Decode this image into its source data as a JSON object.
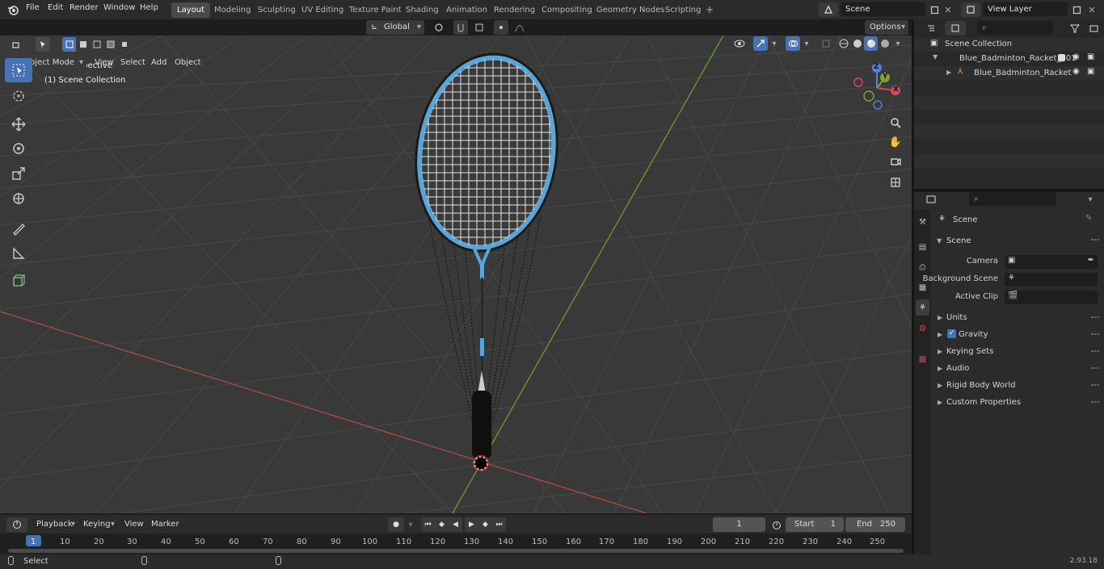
{
  "menu": {
    "items": [
      "File",
      "Edit",
      "Render",
      "Window",
      "Help"
    ]
  },
  "workspaces": [
    "Layout",
    "Modeling",
    "Sculpting",
    "UV Editing",
    "Texture Paint",
    "Shading",
    "Animation",
    "Rendering",
    "Compositing",
    "Geometry Nodes",
    "Scripting"
  ],
  "workspace_add": "+",
  "scene_name": "Scene",
  "view_layer": "View Layer",
  "viewport_header": {
    "mode": "Object Mode",
    "view": "View",
    "select": "Select",
    "add": "Add",
    "object": "Object",
    "transform_orientation": "Global",
    "options": "Options"
  },
  "viewport_overlay": {
    "perspective": "User Perspective",
    "collection": "(1) Scene Collection"
  },
  "gizmo": {
    "z": "Z",
    "y": "Y",
    "x": "X"
  },
  "outliner": {
    "root": "Scene Collection",
    "items": [
      "Blue_Badminton_Racket_001",
      "Blue_Badminton_Racket"
    ]
  },
  "properties": {
    "header": "Scene",
    "section": "Scene",
    "camera_label": "Camera",
    "bg_scene_label": "Background Scene",
    "active_clip_label": "Active Clip",
    "panels": [
      "Units",
      "Gravity",
      "Keying Sets",
      "Audio",
      "Rigid Body World",
      "Custom Properties"
    ]
  },
  "timeline": {
    "playback": "Playback",
    "keying": "Keying",
    "view": "View",
    "marker": "Marker",
    "current_frame": "1",
    "start_label": "Start",
    "start_value": "1",
    "end_label": "End",
    "end_value": "250",
    "ticks": [
      "1",
      "10",
      "20",
      "30",
      "40",
      "50",
      "60",
      "70",
      "80",
      "90",
      "100",
      "110",
      "120",
      "130",
      "140",
      "150",
      "160",
      "170",
      "180",
      "190",
      "200",
      "210",
      "220",
      "230",
      "240",
      "250"
    ]
  },
  "status": {
    "select": "Select",
    "version": "2.93.18"
  },
  "colors": {
    "accent": "#4772b3",
    "x_axis": "#c44c4c",
    "y_axis": "#7ea03a",
    "racket_blue": "#5aa5d6"
  }
}
